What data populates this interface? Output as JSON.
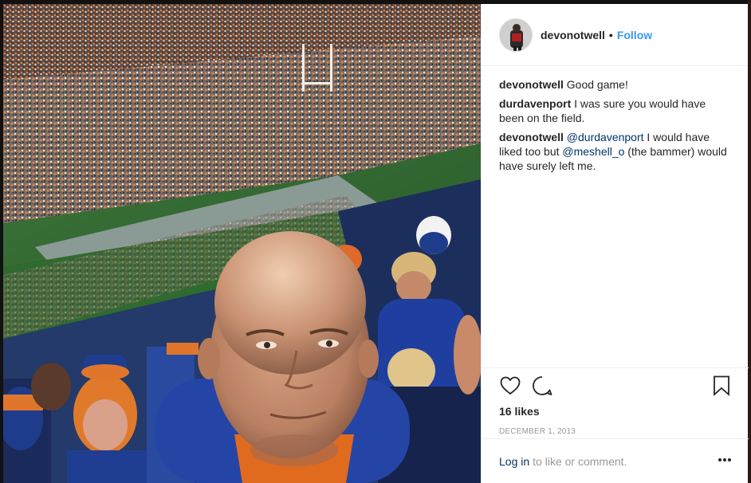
{
  "post": {
    "username": "devonotwell",
    "follow_label": "Follow",
    "separator": "•"
  },
  "comments": [
    {
      "author": "devonotwell",
      "parts": [
        {
          "text": "Good game!"
        }
      ]
    },
    {
      "author": "durdavenport",
      "parts": [
        {
          "text": "I was sure you would have been on the field."
        }
      ]
    },
    {
      "author": "devonotwell",
      "parts": [
        {
          "text": "@durdavenport",
          "mention": true
        },
        {
          "text": " I would have liked too but "
        },
        {
          "text": "@meshell_o",
          "mention": true
        },
        {
          "text": " (the bammer) would have surely left me."
        }
      ]
    }
  ],
  "actions": {
    "like_icon": "heart-icon",
    "comment_icon": "comment-icon",
    "save_icon": "bookmark-icon",
    "likes": "16 likes",
    "date": "DECEMBER 1, 2013"
  },
  "login": {
    "link": "Log in",
    "rest": "to like or comment.",
    "more_icon": "more-options-icon"
  },
  "colors": {
    "link_blue": "#3897f0",
    "mention_blue": "#003569",
    "text": "#262626",
    "muted": "#999999",
    "border": "#efefef"
  }
}
